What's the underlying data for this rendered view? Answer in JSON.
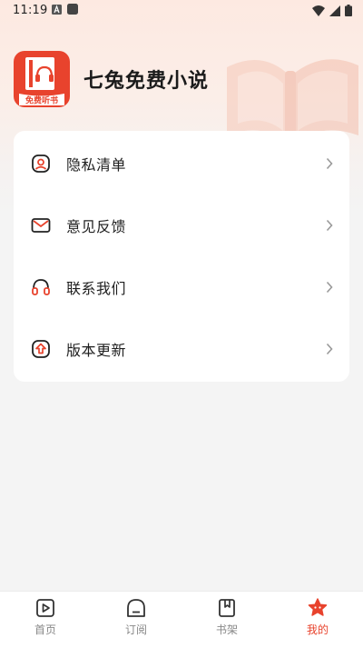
{
  "status_bar": {
    "time": "11:19",
    "left_icons": [
      "a-notification-icon",
      "square-notification-icon"
    ],
    "right_icons": [
      "wifi-icon",
      "signal-icon",
      "battery-icon"
    ]
  },
  "app": {
    "name": "七兔免费小说",
    "logo_text": "免费听书",
    "brand_color": "#e8432d"
  },
  "menu": {
    "items": [
      {
        "label": "隐私清单",
        "icon": "privacy-shield-icon"
      },
      {
        "label": "意见反馈",
        "icon": "mail-icon"
      },
      {
        "label": "联系我们",
        "icon": "headset-icon"
      },
      {
        "label": "版本更新",
        "icon": "update-arrow-icon"
      }
    ]
  },
  "tabs": {
    "items": [
      {
        "label": "首页",
        "icon": "home-play-icon",
        "active": false
      },
      {
        "label": "订阅",
        "icon": "subscribe-icon",
        "active": false
      },
      {
        "label": "书架",
        "icon": "bookshelf-icon",
        "active": false
      },
      {
        "label": "我的",
        "icon": "profile-star-icon",
        "active": true
      }
    ],
    "active_color": "#e8432d",
    "inactive_color": "#888888"
  }
}
